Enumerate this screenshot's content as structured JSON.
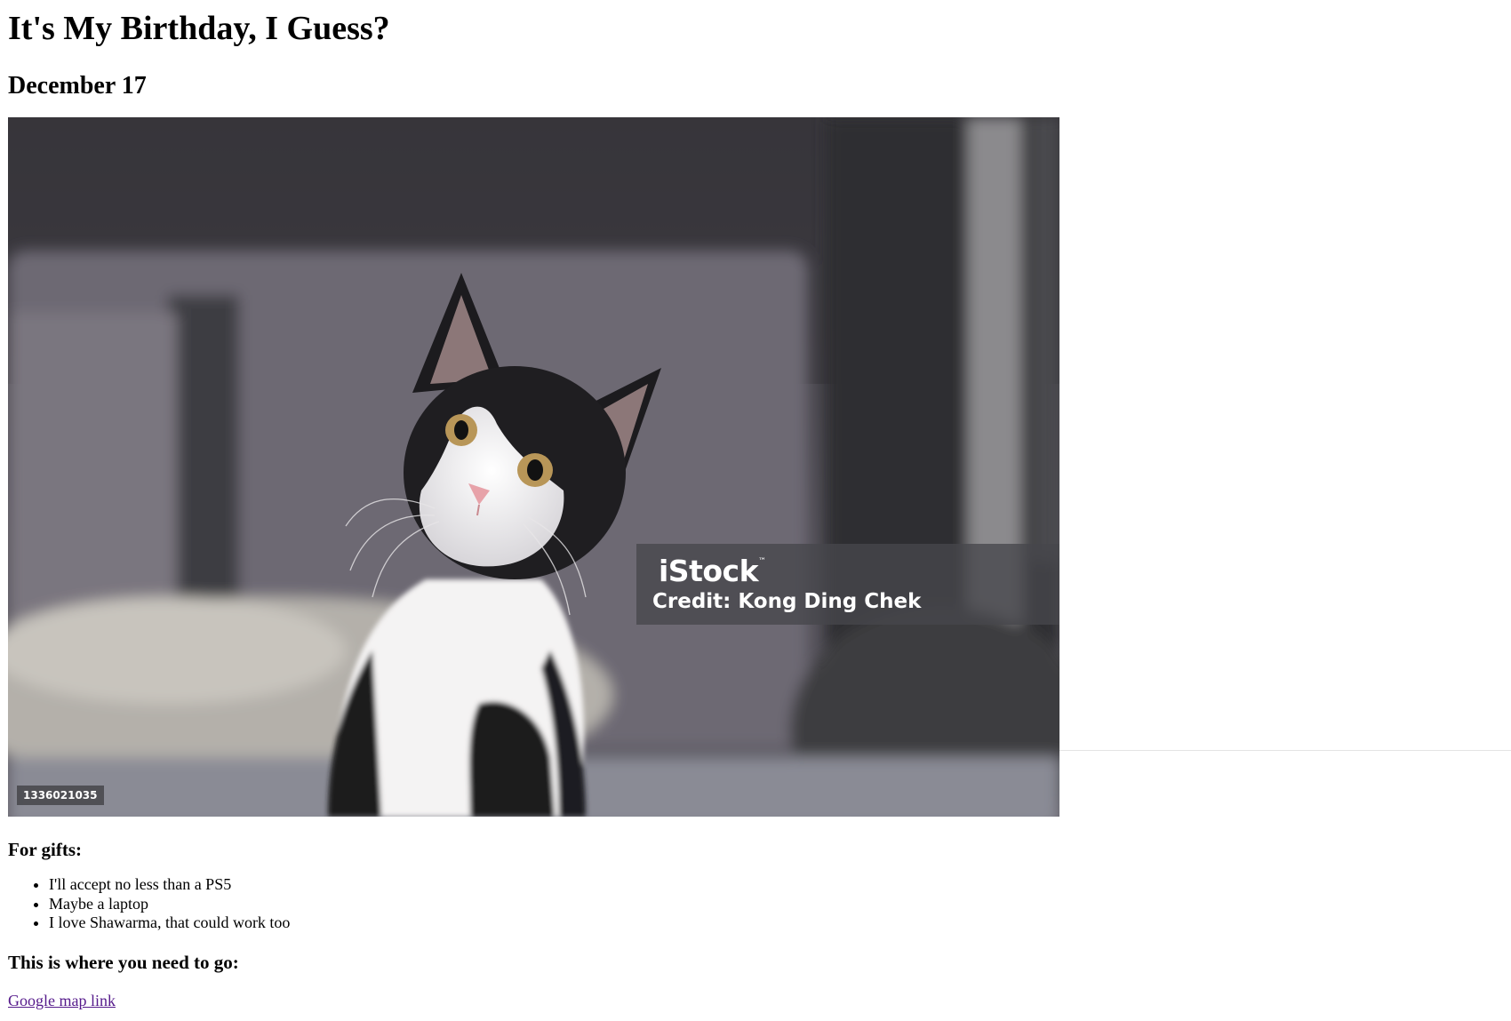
{
  "page": {
    "title": "It's My Birthday, I Guess?",
    "date": "December 17"
  },
  "photo": {
    "watermark_logo": "iStock",
    "watermark_tm": "™",
    "credit": "Credit: Kong Ding Chek",
    "image_id": "1336021035"
  },
  "gifts": {
    "heading": "For gifts:",
    "items": [
      "I'll accept no less than a PS5",
      "Maybe a laptop",
      "I love Shawarma, that could work too"
    ]
  },
  "location": {
    "heading": "This is where you need to go:",
    "link_text": "Google map link"
  },
  "colors": {
    "link_visited": "#551a8b"
  }
}
